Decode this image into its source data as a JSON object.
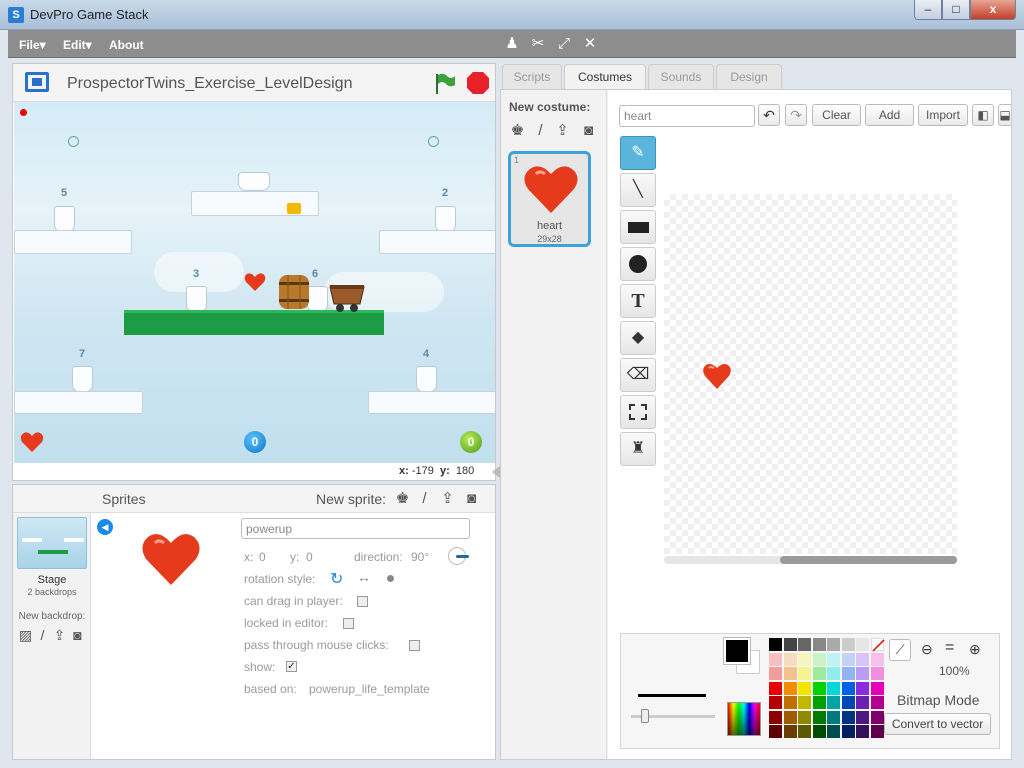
{
  "window": {
    "title": "DevPro Game Stack",
    "app_icon": "S",
    "minimize": "–",
    "maximize": "□",
    "close": "x"
  },
  "menu": {
    "file": "File",
    "edit": "Edit",
    "about": "About"
  },
  "toolbar": {
    "icons": [
      "duplicate-icon",
      "cut-icon",
      "grow-icon",
      "shrink-icon"
    ]
  },
  "stage": {
    "project_title": "ProspectorTwins_Exercise_LevelDesign",
    "platform_numbers": [
      "5",
      "2",
      "3",
      "6",
      "7",
      "4"
    ],
    "coords": {
      "x_label": "x:",
      "x": "-179",
      "y_label": "y:",
      "y": "180"
    }
  },
  "sprites": {
    "title": "Sprites",
    "new_sprite_label": "New sprite:",
    "stage_label": "Stage",
    "stage_backdrops": "2 backdrops",
    "new_backdrop_label": "New backdrop:",
    "name": "powerup",
    "x_label": "x:",
    "x": "0",
    "y_label": "y:",
    "y": "0",
    "direction_label": "direction:",
    "direction": "90°",
    "rotation_style_label": "rotation style:",
    "can_drag_label": "can drag in player:",
    "can_drag": false,
    "locked_label": "locked in editor:",
    "locked": false,
    "pass_through_label": "pass through mouse clicks:",
    "pass_through": false,
    "show_label": "show:",
    "show": true,
    "based_on_label": "based on:",
    "based_on": "powerup_life_template"
  },
  "tabs": [
    {
      "label": "Scripts",
      "active": false
    },
    {
      "label": "Costumes",
      "active": true
    },
    {
      "label": "Sounds",
      "active": false
    },
    {
      "label": "Design",
      "active": false
    }
  ],
  "costumes": {
    "new_costume_label": "New costume:",
    "items": [
      {
        "index": "1",
        "name": "heart",
        "size": "29x28"
      }
    ]
  },
  "editor": {
    "costume_name": "heart",
    "clear": "Clear",
    "add": "Add",
    "import": "Import",
    "zoom": "100%",
    "mode": "Bitmap Mode",
    "convert": "Convert to vector",
    "tools": [
      "brush-icon",
      "line-icon",
      "rectangle-icon",
      "ellipse-icon",
      "text-icon",
      "fill-icon",
      "eraser-icon",
      "select-icon",
      "stamp-icon"
    ],
    "palette": [
      [
        "#000000",
        "#444444",
        "#666666",
        "#888888",
        "#aaaaaa",
        "#cccccc",
        "#e6e6e6",
        "#ffffff"
      ],
      [
        "#f5c0c0",
        "#f5dcbf",
        "#f5f5bf",
        "#c9f2c9",
        "#bff2f2",
        "#c0d3f5",
        "#d7c5f5",
        "#f5c0ec"
      ],
      [
        "#f49c9c",
        "#f5c18f",
        "#f5f58f",
        "#9deb9d",
        "#8feded",
        "#8fb3f5",
        "#b79cf5",
        "#f08fdf"
      ],
      [
        "#e60000",
        "#f28c00",
        "#f2e600",
        "#00d400",
        "#00d9d9",
        "#0060e6",
        "#8a2be2",
        "#e600b8"
      ],
      [
        "#b30000",
        "#c06e00",
        "#c0b800",
        "#00a000",
        "#00a6a6",
        "#0047b3",
        "#6b1fb3",
        "#b3008f"
      ],
      [
        "#8c0000",
        "#a05a00",
        "#8c8a00",
        "#007a00",
        "#007a7a",
        "#003380",
        "#4f1780",
        "#80006b"
      ],
      [
        "#5c0000",
        "#6b3c00",
        "#5c5a00",
        "#004d00",
        "#004d4d",
        "#002060",
        "#35105c",
        "#5c004d"
      ]
    ]
  },
  "colors": {
    "accent": "#5ab4dc",
    "menubar": "#8d8d8d",
    "heart": "#e63a1c",
    "platform_green": "#1e9b45"
  }
}
